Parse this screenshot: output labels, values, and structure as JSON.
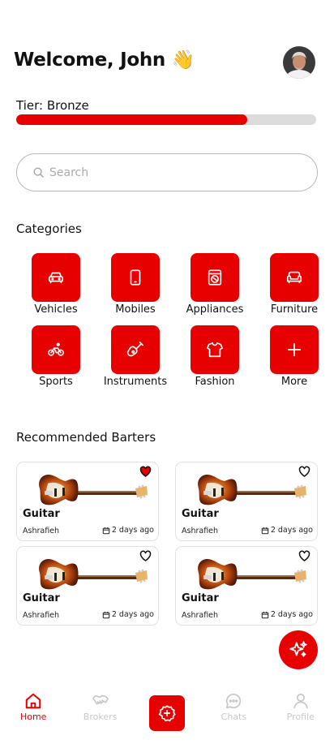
{
  "header": {
    "welcome": "Welcome, John",
    "wave_emoji": "👋",
    "avatar": "user-avatar"
  },
  "tier": {
    "label": "Tier: Bronze",
    "progress": 0.77
  },
  "search": {
    "placeholder": "Search"
  },
  "categories": {
    "title": "Categories",
    "items": [
      {
        "label": "Vehicles",
        "icon": "car-icon"
      },
      {
        "label": "Mobiles",
        "icon": "phone-icon"
      },
      {
        "label": "Appliances",
        "icon": "washing-machine-icon"
      },
      {
        "label": "Furniture",
        "icon": "sofa-icon"
      },
      {
        "label": "Sports",
        "icon": "bicycle-icon"
      },
      {
        "label": "Instruments",
        "icon": "guitar-icon"
      },
      {
        "label": "Fashion",
        "icon": "shirt-icon"
      },
      {
        "label": "More",
        "icon": "plus-icon"
      }
    ]
  },
  "recommended": {
    "title": "Recommended Barters",
    "items": [
      {
        "title": "Guitar",
        "location": "Ashrafieh",
        "date": "2 days ago",
        "favorited": true
      },
      {
        "title": "Guitar",
        "location": "Ashrafieh",
        "date": "2 days ago",
        "favorited": false
      },
      {
        "title": "Guitar",
        "location": "Ashrafieh",
        "date": "2 days ago",
        "favorited": false
      },
      {
        "title": "Guitar",
        "location": "Ashrafieh",
        "date": "2 days ago",
        "favorited": false
      }
    ]
  },
  "nav": {
    "home": "Home",
    "brokers": "Brokers",
    "chats": "Chats",
    "profile": "Profile"
  },
  "colors": {
    "accent": "#e60000",
    "inactive": "#c8c8c8"
  }
}
